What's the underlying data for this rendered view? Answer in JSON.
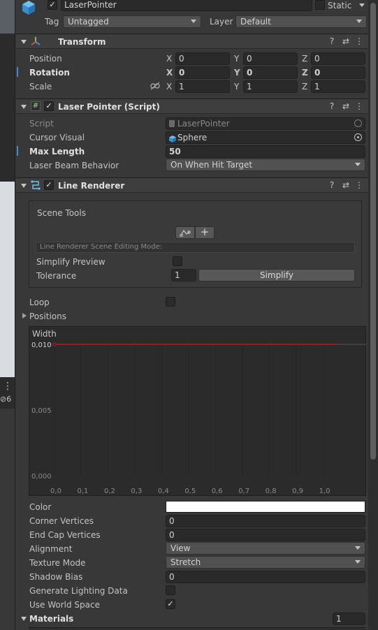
{
  "gameobject": {
    "name": "LaserPointer",
    "active": true,
    "static_label": "Static",
    "tag_label": "Tag",
    "tag_value": "Untagged",
    "layer_label": "Layer",
    "layer_value": "Default"
  },
  "transform": {
    "title": "Transform",
    "rows": [
      {
        "label": "Position",
        "x": "0",
        "y": "0",
        "z": "0"
      },
      {
        "label": "Rotation",
        "x": "0",
        "y": "0",
        "z": "0"
      },
      {
        "label": "Scale",
        "x": "1",
        "y": "1",
        "z": "1"
      }
    ],
    "axis": {
      "x": "X",
      "y": "Y",
      "z": "Z"
    }
  },
  "laser_pointer": {
    "title": "Laser Pointer (Script)",
    "script_label": "Script",
    "script_value": "LaserPointer",
    "cursor_label": "Cursor Visual",
    "cursor_value": "Sphere",
    "maxlen_label": "Max Length",
    "maxlen_value": "50",
    "behavior_label": "Laser Beam Behavior",
    "behavior_value": "On When Hit Target"
  },
  "line_renderer": {
    "title": "Line Renderer",
    "scene_tools_label": "Scene Tools",
    "edit_mode_text": "Line Renderer Scene Editing Mode:",
    "simplify_preview_label": "Simplify Preview",
    "tolerance_label": "Tolerance",
    "tolerance_value": "1",
    "simplify_button": "Simplify",
    "add_button": "+",
    "loop_label": "Loop",
    "positions_label": "Positions",
    "width_label": "Width",
    "color_label": "Color",
    "corner_label": "Corner Vertices",
    "corner_value": "0",
    "endcap_label": "End Cap Vertices",
    "endcap_value": "0",
    "alignment_label": "Alignment",
    "alignment_value": "View",
    "texture_label": "Texture Mode",
    "texture_value": "Stretch",
    "shadow_label": "Shadow Bias",
    "shadow_value": "0",
    "lighting_label": "Generate Lighting Data",
    "worldspace_label": "Use World Space",
    "materials_label": "Materials",
    "materials_count": "1"
  },
  "chart_data": {
    "type": "line",
    "title": "Width",
    "x": [
      0.0,
      1.05
    ],
    "series": [
      {
        "values": [
          0.01,
          0.01
        ]
      }
    ],
    "x_ticks": [
      "0,0",
      "0,1",
      "0,2",
      "0,3",
      "0,4",
      "0,5",
      "0,6",
      "0,7",
      "0,8",
      "0,9",
      "1,0"
    ],
    "y_ticks": [
      "0,010",
      "0,005",
      "0,000"
    ],
    "xlim": [
      0,
      1.1
    ],
    "ylim": [
      0,
      0.01
    ],
    "line_color": "#b01c1c"
  },
  "left_panel": {
    "count": "6"
  }
}
